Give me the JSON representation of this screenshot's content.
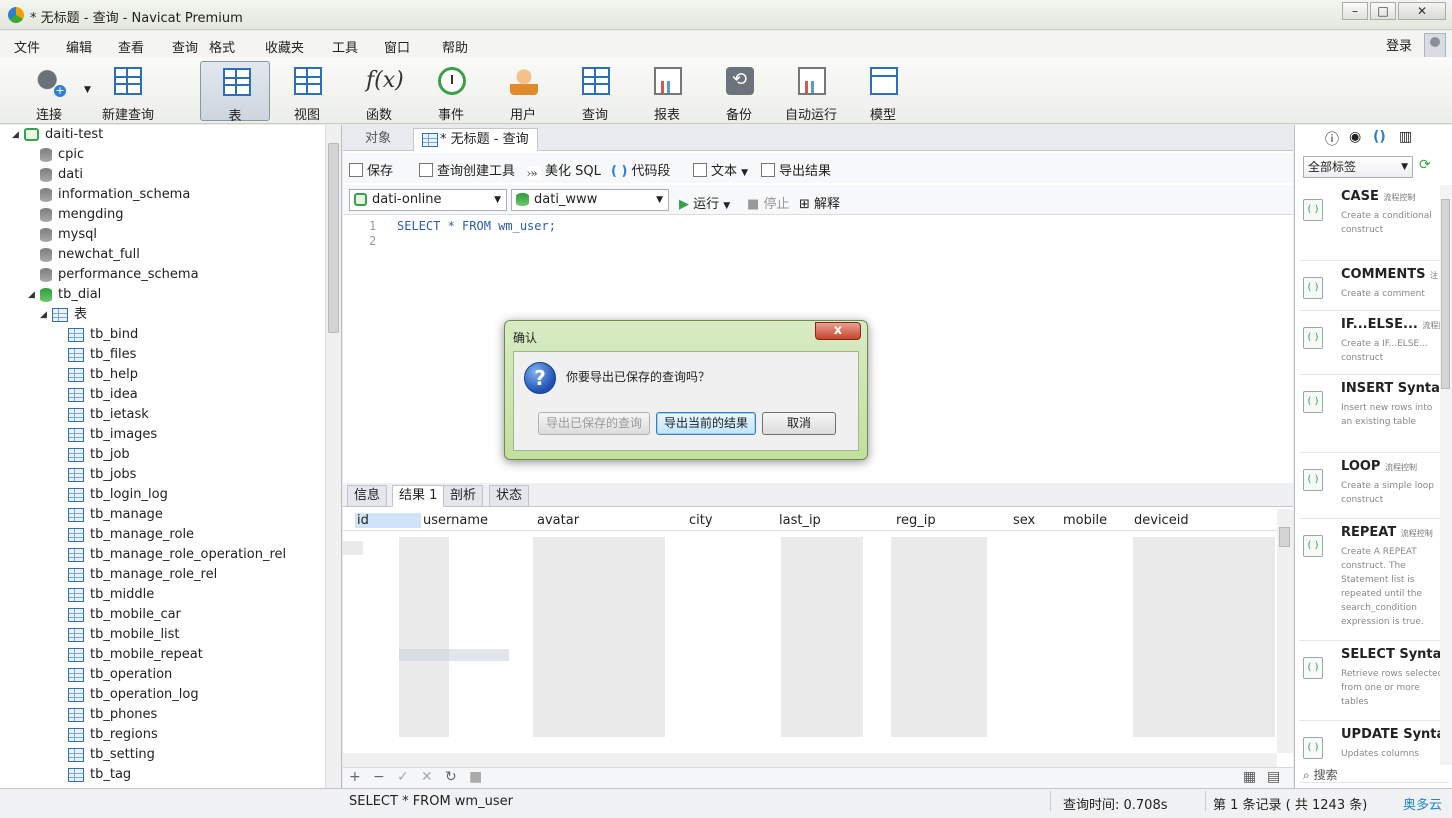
{
  "window": {
    "title": "* 无标题 - 查询 - Navicat Premium"
  },
  "menu": {
    "items": [
      "文件",
      "编辑",
      "查看",
      "查询",
      "格式",
      "收藏夹",
      "工具",
      "窗口",
      "帮助"
    ],
    "login": "登录"
  },
  "toolbar": {
    "buttons": [
      {
        "label": "连接",
        "icon": "plug-icon"
      },
      {
        "label": "新建查询",
        "icon": "new-query-icon"
      },
      {
        "label": "表",
        "icon": "table-icon"
      },
      {
        "label": "视图",
        "icon": "view-icon"
      },
      {
        "label": "函数",
        "icon": "function-icon",
        "glyph": "f(x)"
      },
      {
        "label": "事件",
        "icon": "clock-icon"
      },
      {
        "label": "用户",
        "icon": "user-icon"
      },
      {
        "label": "查询",
        "icon": "query-icon"
      },
      {
        "label": "报表",
        "icon": "report-icon"
      },
      {
        "label": "备份",
        "icon": "backup-icon"
      },
      {
        "label": "自动运行",
        "icon": "schedule-icon"
      },
      {
        "label": "模型",
        "icon": "model-icon"
      }
    ]
  },
  "tree": {
    "connection": "daiti-test",
    "databases": [
      "cpic",
      "dati",
      "information_schema",
      "mengding",
      "mysql",
      "newchat_full",
      "performance_schema"
    ],
    "open_db": "tb_dial",
    "tables_folder": "表",
    "tables": [
      "tb_bind",
      "tb_files",
      "tb_help",
      "tb_idea",
      "tb_ietask",
      "tb_images",
      "tb_job",
      "tb_jobs",
      "tb_login_log",
      "tb_manage",
      "tb_manage_role",
      "tb_manage_role_operation_rel",
      "tb_manage_role_rel",
      "tb_middle",
      "tb_mobile_car",
      "tb_mobile_list",
      "tb_mobile_repeat",
      "tb_operation",
      "tb_operation_log",
      "tb_phones",
      "tb_regions",
      "tb_setting",
      "tb_tag"
    ]
  },
  "tabs": {
    "objects": "对象",
    "query": "* 无标题 - 查询"
  },
  "query_toolbar": {
    "save": "保存",
    "builder": "查询创建工具",
    "beautify": "美化 SQL",
    "snippet": "代码段",
    "text": "文本",
    "export": "导出结果"
  },
  "query_bar": {
    "connection": "dati-online",
    "database": "dati_www",
    "run": "运行",
    "stop": "停止",
    "explain": "解释"
  },
  "editor": {
    "lines": [
      "1",
      "2"
    ],
    "code": "SELECT * FROM wm_user;"
  },
  "result_tabs": [
    "信息",
    "结果 1",
    "剖析",
    "状态"
  ],
  "grid": {
    "columns": [
      "id",
      "username",
      "avatar",
      "city",
      "last_ip",
      "reg_ip",
      "sex",
      "mobile",
      "deviceid"
    ]
  },
  "right_panel": {
    "filter": "全部标签",
    "search": "搜索",
    "snippets": [
      {
        "name": "CASE",
        "tag": "流程控制",
        "desc": "Create a conditional construct"
      },
      {
        "name": "COMMENTS",
        "tag": "注",
        "desc": "Create a comment"
      },
      {
        "name": "IF...ELSE...",
        "tag": "流程控",
        "desc": "Create a IF...ELSE... construct"
      },
      {
        "name": "INSERT Syntax",
        "tag": "",
        "desc": "Insert new rows into an existing table"
      },
      {
        "name": "LOOP",
        "tag": "流程控制",
        "desc": "Create a simple loop construct"
      },
      {
        "name": "REPEAT",
        "tag": "流程控制",
        "desc": "Create A REPEAT construct. The Statement list is repeated until the search_condition expression is true."
      },
      {
        "name": "SELECT Syntax",
        "tag": "",
        "desc": "Retrieve rows selected from one or more tables"
      },
      {
        "name": "UPDATE Synta",
        "tag": "",
        "desc": "Updates columns"
      }
    ]
  },
  "status": {
    "sql": "SELECT * FROM wm_user",
    "time": "查询时间: 0.708s",
    "records": "第 1 条记录 ( 共 1243 条)"
  },
  "watermark": "奥多云",
  "dialog": {
    "title": "确认",
    "message": "你要导出已保存的查询吗？",
    "btn_saved": "导出已保存的查询",
    "btn_current": "导出当前的结果",
    "btn_cancel": "取消"
  }
}
